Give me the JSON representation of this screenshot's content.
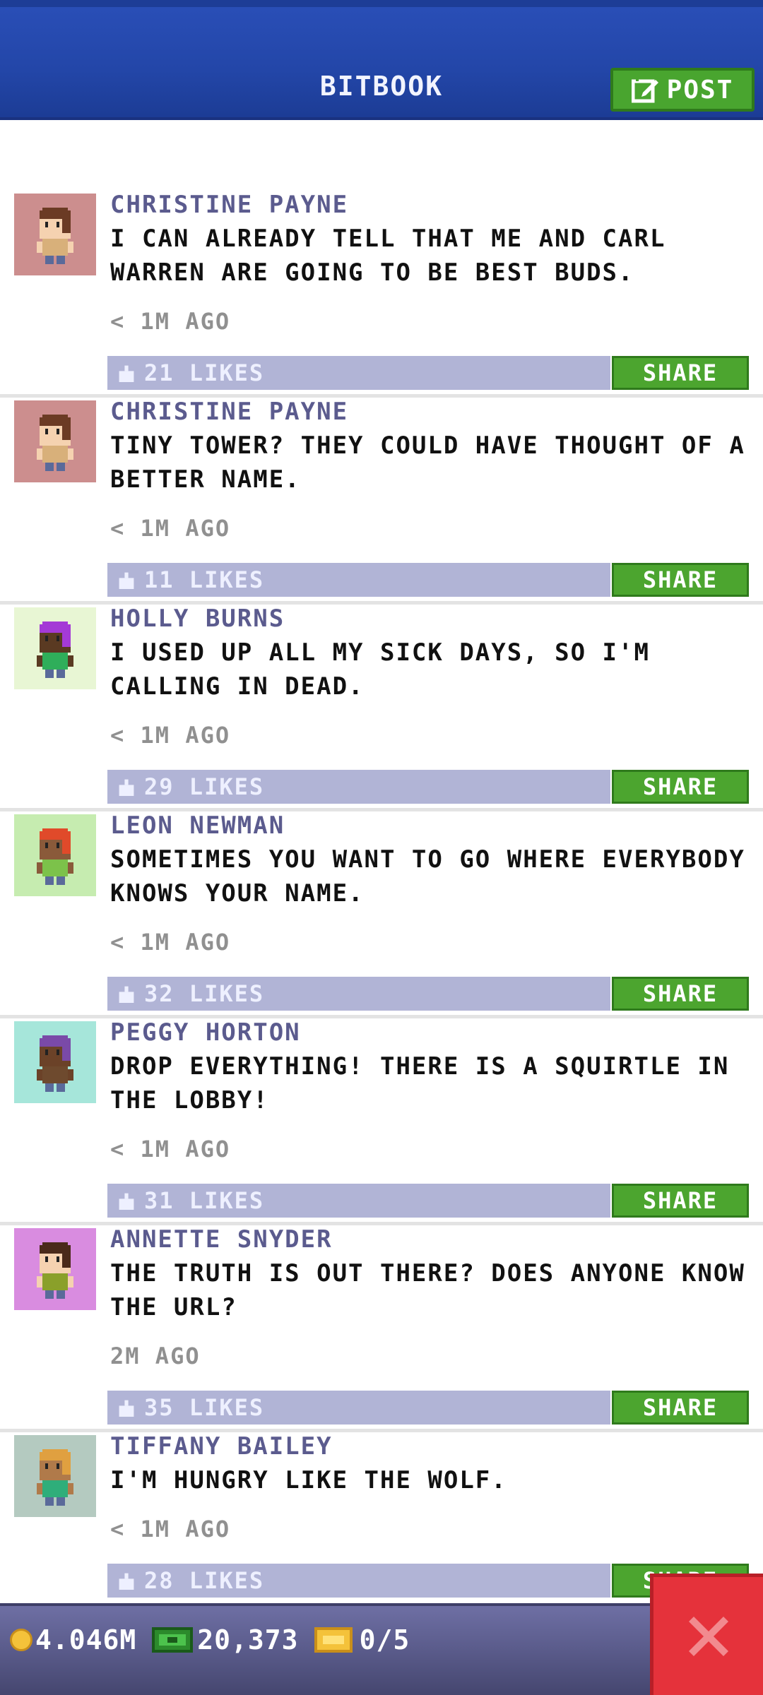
{
  "header": {
    "title": "BITBOOK",
    "post_label": "POST"
  },
  "colors": {
    "header_blue": "#2346a8",
    "accent_green": "#49a52f",
    "likes_bar": "#b1b4d6",
    "author_purple": "#5b5b8e",
    "close_red": "#e5323b"
  },
  "posts": [
    {
      "author": "CHRISTINE PAYNE",
      "message": "I CAN ALREADY TELL THAT ME AND CARL WARREN ARE GOING TO BE BEST BUDS.",
      "time": "< 1M AGO",
      "likes": "21 LIKES",
      "share_label": "SHARE",
      "avatar": "avatar-brown-hair",
      "avatar_bg": "#cc8e8e",
      "hair": "#6b3b24",
      "skin": "#f5d2b0",
      "shirt": "#d8b07a"
    },
    {
      "author": "CHRISTINE PAYNE",
      "message": "TINY TOWER? THEY COULD HAVE THOUGHT OF A BETTER NAME.",
      "time": "< 1M AGO",
      "likes": "11 LIKES",
      "share_label": "SHARE",
      "avatar": "avatar-brown-hair",
      "avatar_bg": "#cc8e8e",
      "hair": "#6b3b24",
      "skin": "#f5d2b0",
      "shirt": "#d8b07a"
    },
    {
      "author": "HOLLY BURNS",
      "message": "I USED UP ALL MY SICK DAYS, SO I'M CALLING IN DEAD.",
      "time": "< 1M AGO",
      "likes": "29 LIKES",
      "share_label": "SHARE",
      "avatar": "avatar-purple-hat",
      "avatar_bg": "#e8f6d4",
      "hair": "#a43ad6",
      "skin": "#5a3a22",
      "shirt": "#2fae5a"
    },
    {
      "author": "LEON NEWMAN",
      "message": "SOMETIMES YOU WANT TO GO WHERE EVERYBODY KNOWS YOUR NAME.",
      "time": "< 1M AGO",
      "likes": "32 LIKES",
      "share_label": "SHARE",
      "avatar": "avatar-red-hair",
      "avatar_bg": "#c6ecb0",
      "hair": "#e04a2a",
      "skin": "#8a5a3a",
      "shirt": "#7cc24a"
    },
    {
      "author": "PEGGY HORTON",
      "message": "DROP EVERYTHING! THERE IS A SQUIRTLE IN THE LOBBY!",
      "time": "< 1M AGO",
      "likes": "31 LIKES",
      "share_label": "SHARE",
      "avatar": "avatar-purple-hair",
      "avatar_bg": "#a6e6da",
      "hair": "#7a4aa8",
      "skin": "#6b4228",
      "shirt": "#6e4a2e"
    },
    {
      "author": "ANNETTE SNYDER",
      "message": "THE TRUTH IS OUT THERE? DOES ANYONE KNOW THE URL?",
      "time": "2M AGO",
      "likes": "35 LIKES",
      "share_label": "SHARE",
      "avatar": "avatar-dark-hair",
      "avatar_bg": "#d98ce0",
      "hair": "#4a2a1a",
      "skin": "#f5d2b0",
      "shirt": "#8aa02a"
    },
    {
      "author": "TIFFANY BAILEY",
      "message": "I'M HUNGRY LIKE THE WOLF.",
      "time": "< 1M AGO",
      "likes": "28 LIKES",
      "share_label": "SHARE",
      "avatar": "avatar-blonde-hair",
      "avatar_bg": "#b4cac0",
      "hair": "#e0a040",
      "skin": "#b07a4a",
      "shirt": "#2fae7a"
    }
  ],
  "bottom_bar": {
    "coins": "4.046M",
    "bux": "20,373",
    "tickets": "0/5"
  }
}
